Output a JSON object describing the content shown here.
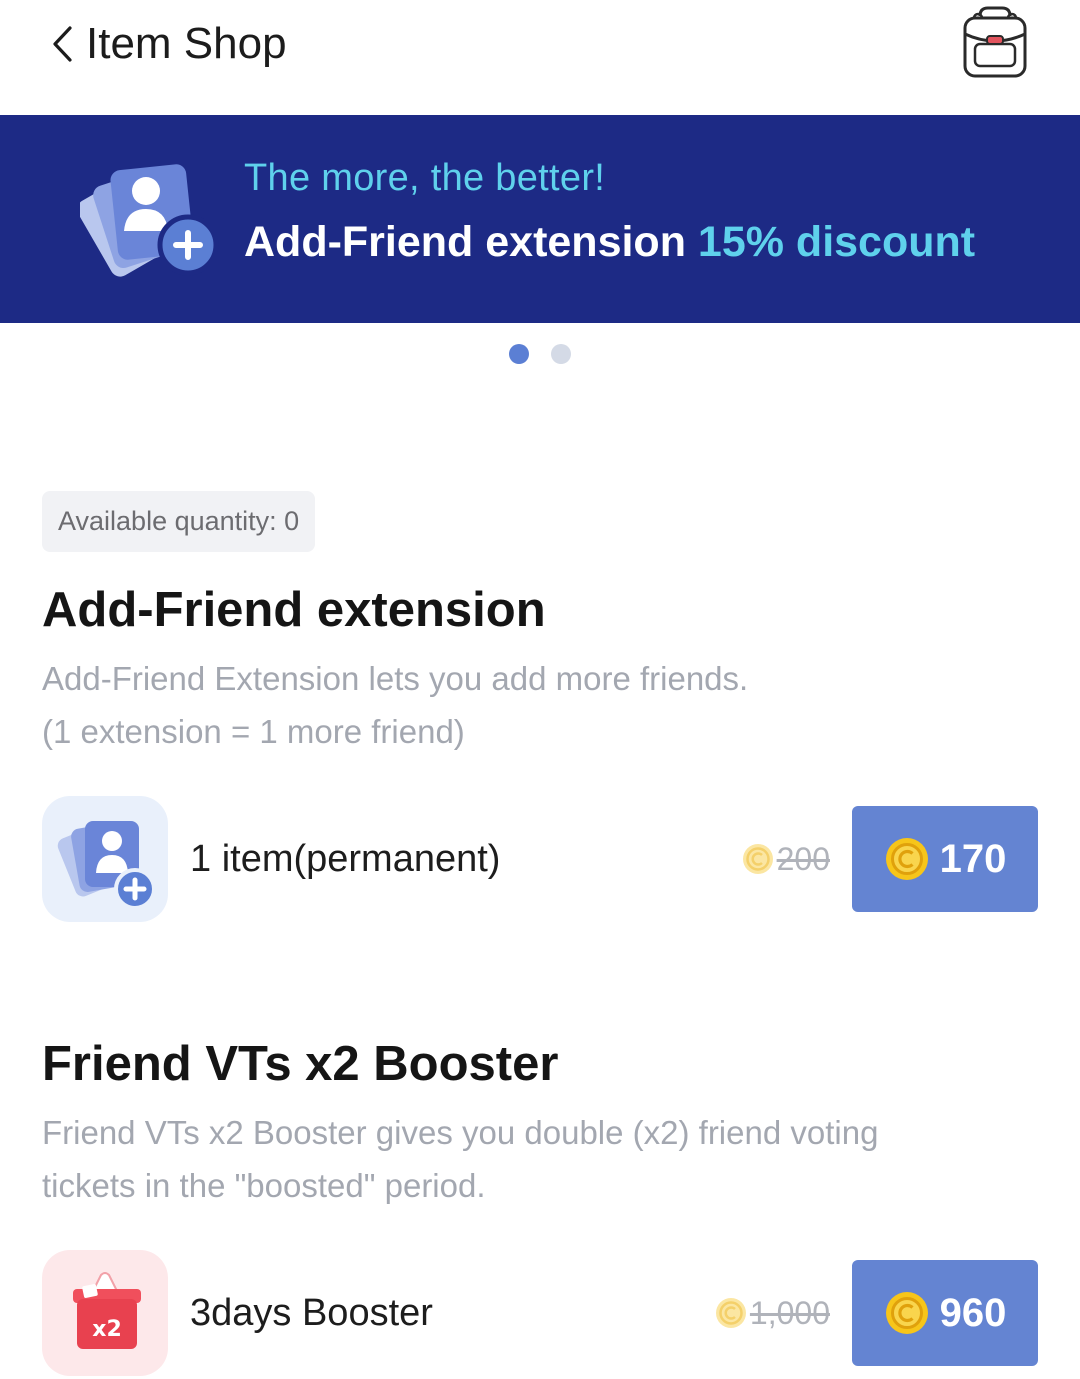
{
  "header": {
    "title": "Item Shop",
    "back_icon": "chevron-left-icon",
    "bag_icon": "backpack-icon"
  },
  "banner": {
    "line1": "The more, the better!",
    "line2_prefix": "Add-Friend extension ",
    "line2_highlight": "15% discount",
    "icon": "add-friend-cards-icon"
  },
  "carousel": {
    "pages": 2,
    "active_index": 0
  },
  "available_quantity": "Available quantity: 0",
  "sections": [
    {
      "title": "Add-Friend extension",
      "description": "Add-Friend Extension lets you add more friends.\n(1 extension = 1 more friend)",
      "item": {
        "label": "1 item(permanent)",
        "old_price": "200",
        "price": "170",
        "icon": "add-friend-icon"
      }
    },
    {
      "title": "Friend VTs x2 Booster",
      "description": "Friend VTs x2 Booster gives you double (x2) friend voting tickets in the \"boosted\" period.",
      "item": {
        "label": "3days Booster",
        "old_price": "1,000",
        "price": "960",
        "icon": "x2-booster-box-icon",
        "icon_text": "x2"
      }
    }
  ],
  "colors": {
    "banner_bg": "#1d2a85",
    "banner_highlight": "#5fd1ec",
    "button_bg": "#6484d2",
    "coin": "#f5c518",
    "dot_active": "#5b7fd4",
    "dot_inactive": "#d4dae6"
  }
}
